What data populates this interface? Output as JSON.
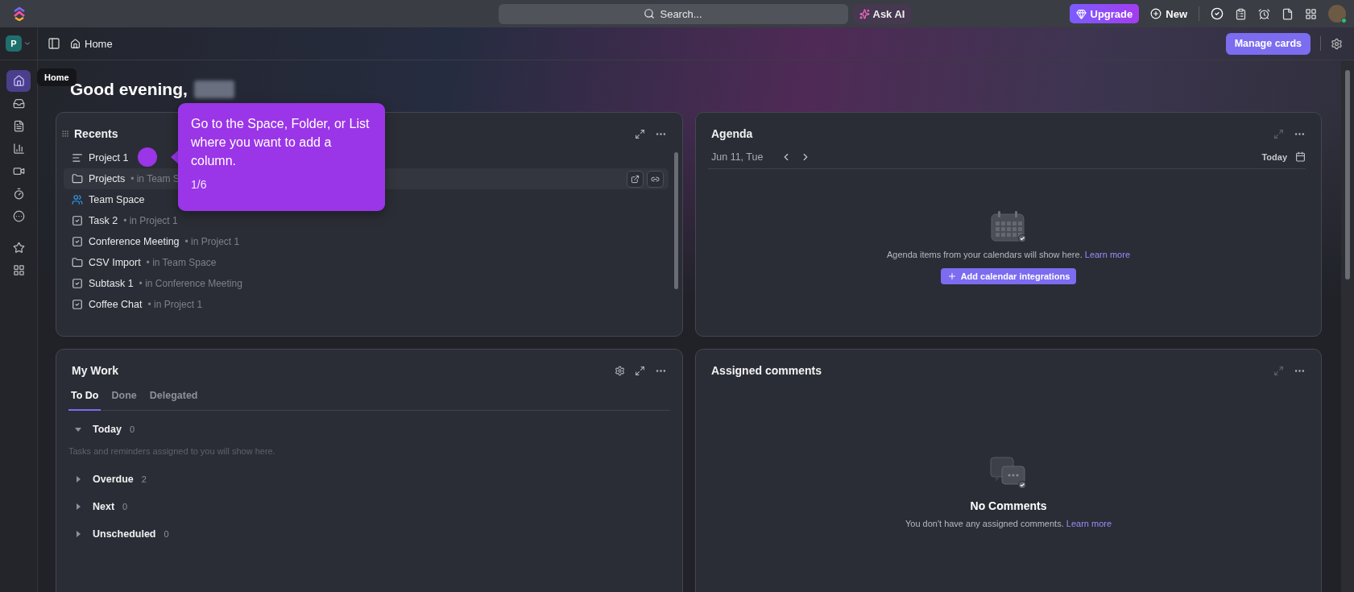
{
  "topbar": {
    "search_placeholder": "Search...",
    "ask_ai": "Ask AI",
    "upgrade": "Upgrade",
    "new": "New"
  },
  "workspace": {
    "initial": "P"
  },
  "breadcrumb": "Home",
  "manage_cards": "Manage cards",
  "sidebar": {
    "tooltip": "Home",
    "items": [
      {
        "kind": "home",
        "selected": true
      },
      {
        "kind": "inbox",
        "selected": false
      },
      {
        "kind": "docs",
        "selected": false
      },
      {
        "kind": "dashboards",
        "selected": false
      },
      {
        "kind": "video",
        "selected": false
      },
      {
        "kind": "timer",
        "selected": false
      },
      {
        "kind": "more",
        "selected": false
      },
      {
        "kind": "favorites",
        "selected": false
      },
      {
        "kind": "apps",
        "selected": false
      }
    ]
  },
  "greeting": "Good evening,",
  "recents": {
    "title": "Recents",
    "rows": [
      {
        "kind": "list",
        "name": "Project 1",
        "highlighted": false
      },
      {
        "kind": "folder",
        "name": "Projects",
        "context": "• in Team S",
        "highlighted": true
      },
      {
        "kind": "space",
        "name": "Team Space",
        "highlighted": false
      },
      {
        "kind": "task",
        "name": "Task 2",
        "context": "• in Project 1",
        "highlighted": false
      },
      {
        "kind": "task",
        "name": "Conference Meeting",
        "context": "• in Project 1",
        "highlighted": false
      },
      {
        "kind": "folder",
        "name": "CSV Import",
        "context": "• in Team Space",
        "highlighted": false
      },
      {
        "kind": "task",
        "name": "Subtask 1",
        "context": "• in Conference Meeting",
        "highlighted": false
      },
      {
        "kind": "task",
        "name": "Coffee Chat",
        "context": "• in Project 1",
        "highlighted": false
      }
    ]
  },
  "tour": {
    "text": "Go to the Space, Folder, or List where you want to add a column.",
    "step": "1/6"
  },
  "agenda": {
    "title": "Agenda",
    "date": "Jun 11, Tue",
    "today": "Today",
    "message": "Agenda items from your calendars will show here.",
    "link": "Learn more",
    "button": "Add calendar integrations"
  },
  "my_work": {
    "title": "My Work",
    "tabs": [
      {
        "label": "To Do",
        "selected": true
      },
      {
        "label": "Done",
        "selected": false
      },
      {
        "label": "Delegated",
        "selected": false
      }
    ],
    "groups": [
      {
        "label": "Today",
        "count": "0",
        "expanded": true,
        "empty": "Tasks and reminders assigned to you will show here."
      },
      {
        "label": "Overdue",
        "count": "2",
        "expanded": false
      },
      {
        "label": "Next",
        "count": "0",
        "expanded": false
      },
      {
        "label": "Unscheduled",
        "count": "0",
        "expanded": false
      }
    ]
  },
  "comments": {
    "title": "Assigned comments",
    "heading": "No Comments",
    "message": "You don't have any assigned comments.",
    "link": "Learn more"
  }
}
